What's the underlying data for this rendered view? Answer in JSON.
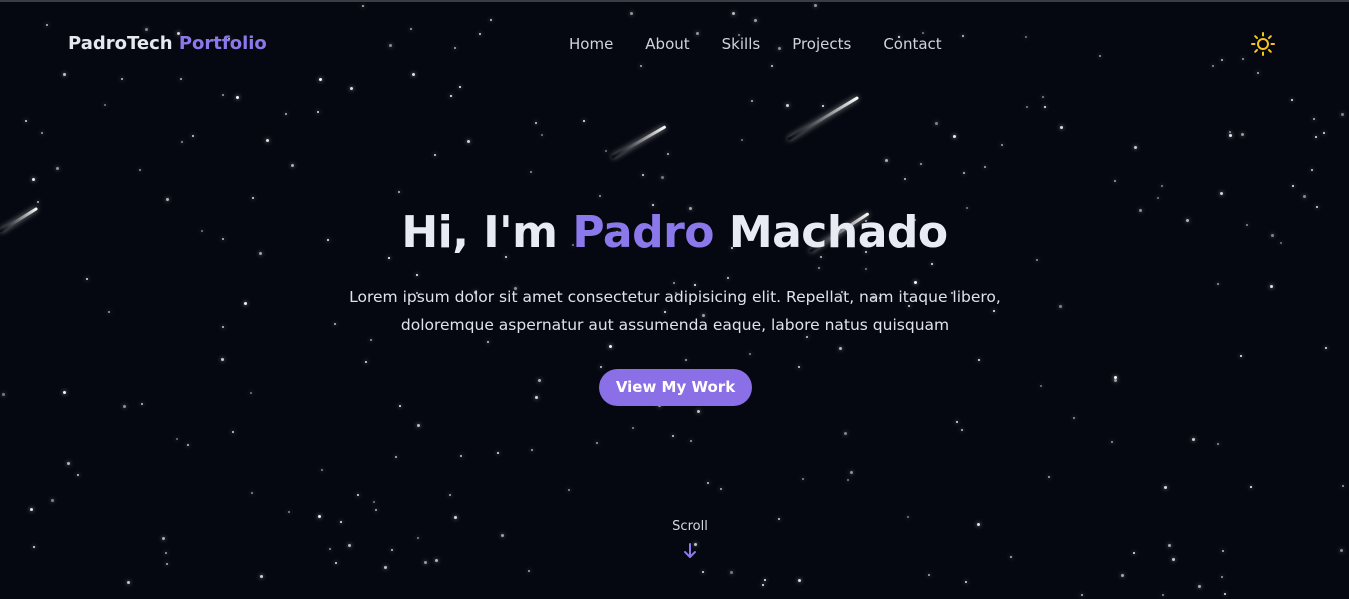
{
  "brand": {
    "name_part1": "PadroTech",
    "name_part2": "Portfolio"
  },
  "nav": {
    "items": [
      {
        "label": "Home"
      },
      {
        "label": "About"
      },
      {
        "label": "Skills"
      },
      {
        "label": "Projects"
      },
      {
        "label": "Contact"
      }
    ]
  },
  "theme_toggle": {
    "icon": "sun-icon"
  },
  "hero": {
    "greeting": "Hi, I'm",
    "first_name": "Padro",
    "last_name": "Machado",
    "subtitle": "Lorem ipsum dolor sit amet consectetur adipisicing elit. Repellat, nam itaque libero, doloremque aspernatur aut assumenda eaque, labore natus quisquam",
    "cta_label": "View My Work"
  },
  "scroll": {
    "label": "Scroll",
    "icon": "arrow-down-icon"
  },
  "colors": {
    "background": "#060811",
    "accent": "#8b78ea",
    "button": "#8b6fe6",
    "text": "#e8eaf4",
    "sun": "#f5c518"
  }
}
